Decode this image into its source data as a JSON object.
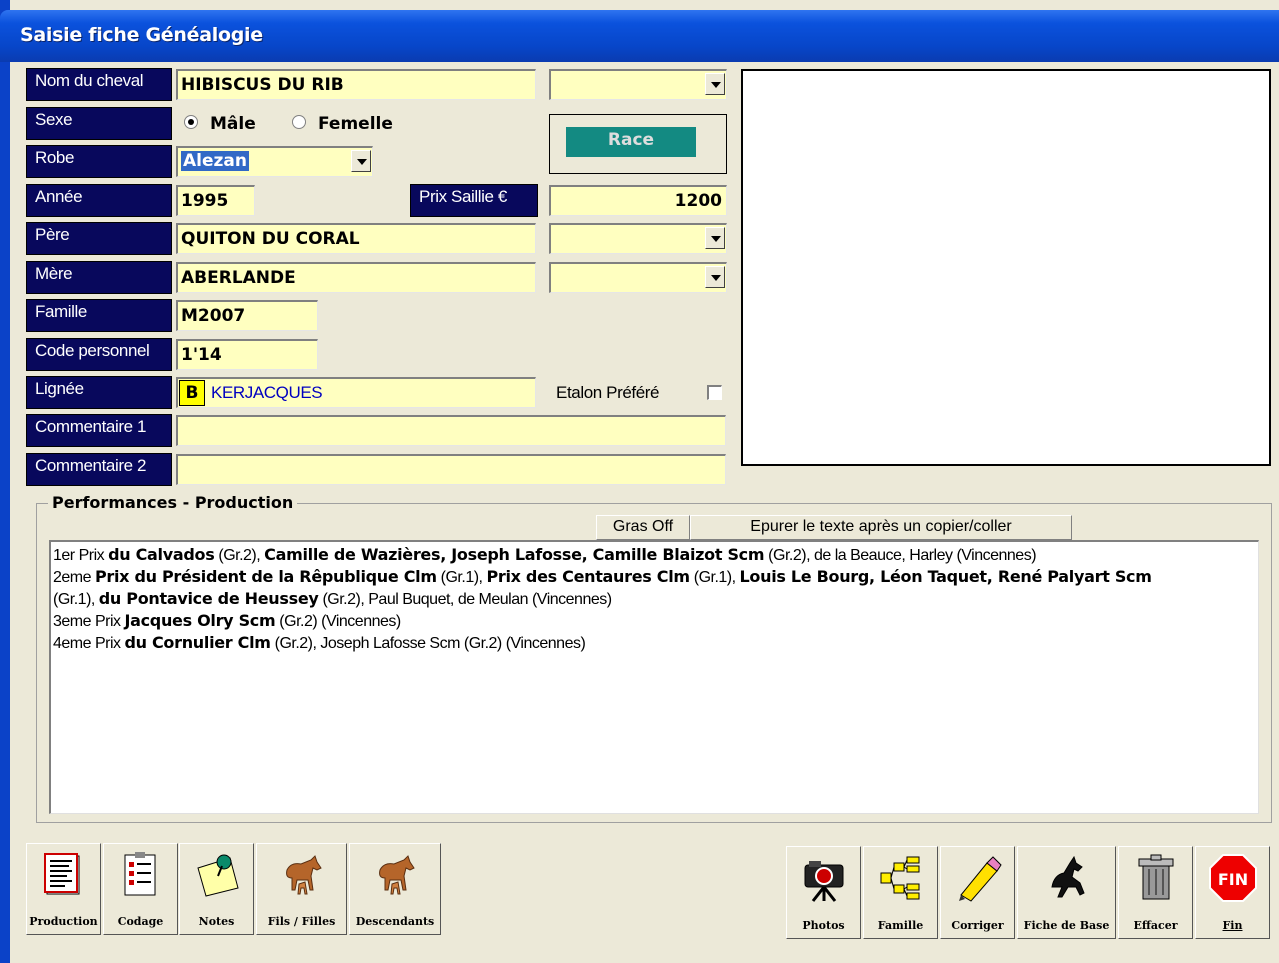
{
  "window": {
    "title": "Saisie fiche Généalogie"
  },
  "labels": {
    "nom": "Nom du cheval",
    "sexe": "Sexe",
    "robe": "Robe",
    "annee": "Année",
    "prix_saillie": "Prix Saillie €",
    "pere": "Père",
    "mere": "Mère",
    "famille": "Famille",
    "code": "Code personnel",
    "lignee": "Lignée",
    "comm1": "Commentaire 1",
    "comm2": "Commentaire 2"
  },
  "fields": {
    "nom": "HIBISCUS DU RIB",
    "nom_combo": "",
    "robe": "Alezan",
    "annee": "1995",
    "prix_saillie": "1200",
    "pere": "QUITON DU CORAL",
    "pere_combo": "",
    "mere": "ABERLANDE",
    "mere_combo": "",
    "famille": "M2007",
    "code": "1'14",
    "lignee_letter": "B",
    "lignee": "KERJACQUES",
    "comm1": "",
    "comm2": ""
  },
  "sexe": {
    "male": "Mâle",
    "femelle": "Femelle",
    "selected": "male"
  },
  "race_button": "Race",
  "etalon_prefere": {
    "label": "Etalon Préféré",
    "checked": false
  },
  "performances": {
    "group_title": "Performances - Production",
    "gras_off": "Gras Off",
    "epurer": "Epurer le texte après un copier/coller",
    "lines": [
      [
        [
          "1er Prix ",
          0
        ],
        [
          "du Calvados",
          1
        ],
        [
          " (Gr.2), ",
          0
        ],
        [
          "Camille de Wazières, Joseph Lafosse, Camille Blaizot Scm",
          1
        ],
        [
          " (Gr.2), de la Beauce, Harley (Vincennes)",
          0
        ]
      ],
      [
        [
          "2eme ",
          0
        ],
        [
          "Prix du Président de la Rêpublique Clm",
          1
        ],
        [
          " (Gr.1), ",
          0
        ],
        [
          "Prix des Centaures Clm",
          1
        ],
        [
          " (Gr.1), ",
          0
        ],
        [
          "Louis Le Bourg, Léon Taquet, René Palyart Scm",
          1
        ]
      ],
      [
        [
          "(Gr.1), ",
          0
        ],
        [
          "du Pontavice de Heussey",
          1
        ],
        [
          " (Gr.2), Paul Buquet, de Meulan (Vincennes)",
          0
        ]
      ],
      [
        [
          "3eme Prix ",
          0
        ],
        [
          "Jacques Olry Scm",
          1
        ],
        [
          " (Gr.2) (Vincennes)",
          0
        ]
      ],
      [
        [
          "4eme Prix ",
          0
        ],
        [
          "du Cornulier Clm",
          1
        ],
        [
          " (Gr.2), Joseph Lafosse Scm (Gr.2) (Vincennes)",
          0
        ]
      ]
    ]
  },
  "toolbar_left": [
    "Production",
    "Codage",
    "Notes",
    "Fils / Filles",
    "Descendants"
  ],
  "toolbar_right": [
    "Photos",
    "Famille",
    "Corriger",
    "Fiche de Base",
    "Effacer",
    "Fin"
  ],
  "fin_icon_text": "FIN"
}
